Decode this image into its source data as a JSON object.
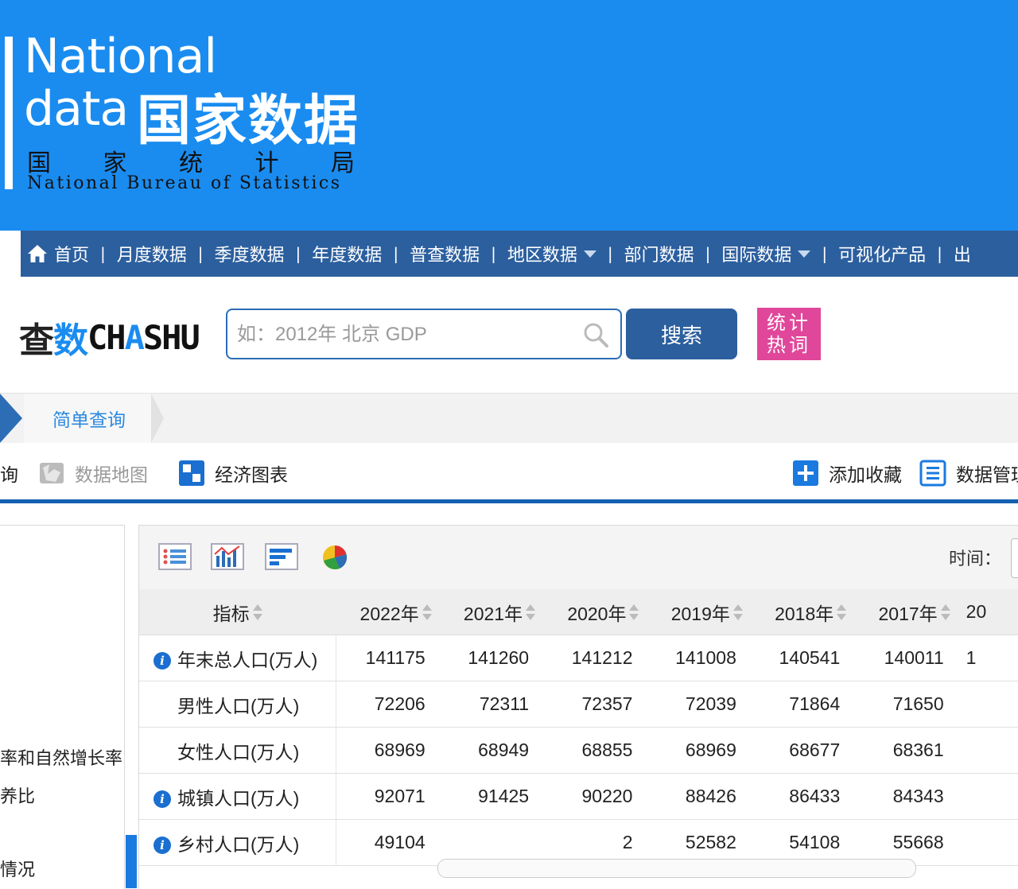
{
  "header": {
    "logo_en_line1": "National",
    "logo_en_line2": "data",
    "logo_cn": "国家数据",
    "bureau_cn": [
      "国",
      "家",
      "统",
      "计",
      "局"
    ],
    "bureau_en": "National Bureau of Statistics"
  },
  "nav": {
    "items": [
      {
        "label": "首页"
      },
      {
        "label": "月度数据"
      },
      {
        "label": "季度数据"
      },
      {
        "label": "年度数据"
      },
      {
        "label": "普查数据"
      },
      {
        "label": "地区数据"
      },
      {
        "label": "部门数据"
      },
      {
        "label": "国际数据"
      },
      {
        "label": "可视化产品"
      },
      {
        "label": "出"
      }
    ]
  },
  "search": {
    "logo_part1": "查",
    "logo_part2": "数",
    "logo_part3": "CH",
    "logo_part4": "A",
    "logo_part5": "SHU",
    "placeholder": "如：2012年 北京 GDP",
    "button_label": "搜索",
    "hot_words_line1": "统计",
    "hot_words_line2": "热词"
  },
  "breadcrumb": {
    "label": "简单查询"
  },
  "toolbar": {
    "cut_label": "询",
    "data_map": "数据地图",
    "econ_chart": "经济图表",
    "add_favorite": "添加收藏",
    "data_manage": "数据管理"
  },
  "left_panel": {
    "items": [
      "率和自然增长率",
      "养比",
      "情况"
    ]
  },
  "table": {
    "time_label": "时间：",
    "header_indicator": "指标",
    "years": [
      "2022年",
      "2021年",
      "2020年",
      "2019年",
      "2018年",
      "2017年",
      "20"
    ],
    "rows": [
      {
        "name": "年末总人口(万人)",
        "info": true,
        "values": [
          "141175",
          "141260",
          "141212",
          "141008",
          "140541",
          "140011",
          "1"
        ]
      },
      {
        "name": "男性人口(万人)",
        "info": false,
        "values": [
          "72206",
          "72311",
          "72357",
          "72039",
          "71864",
          "71650",
          ""
        ]
      },
      {
        "name": "女性人口(万人)",
        "info": false,
        "values": [
          "68969",
          "68949",
          "68855",
          "68969",
          "68677",
          "68361",
          ""
        ]
      },
      {
        "name": "城镇人口(万人)",
        "info": true,
        "values": [
          "92071",
          "91425",
          "90220",
          "88426",
          "86433",
          "84343",
          ""
        ]
      },
      {
        "name": "乡村人口(万人)",
        "info": true,
        "values": [
          "49104",
          "",
          "2",
          "52582",
          "54108",
          "55668",
          ""
        ]
      }
    ]
  },
  "colors": {
    "header_blue": "#1a8cf0",
    "nav_blue": "#2c5f9e",
    "hot_pink": "#e0479a"
  }
}
